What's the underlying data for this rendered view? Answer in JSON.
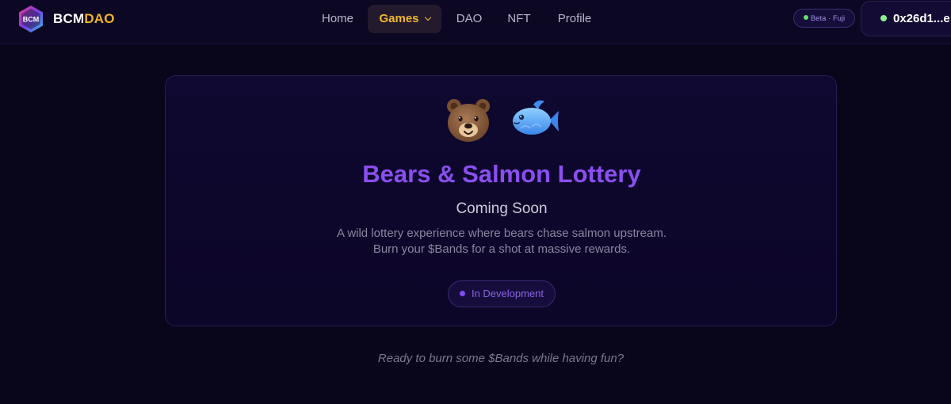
{
  "brand": {
    "part1": "BCM",
    "part2": "DAO",
    "logo_text": "BCM"
  },
  "nav": {
    "home": "Home",
    "games": "Games",
    "dao": "DAO",
    "nft": "NFT",
    "profile": "Profile"
  },
  "network": {
    "label": "Beta · Fuji",
    "status_color": "#66e06d"
  },
  "wallet": {
    "address": "0x26d1...e"
  },
  "game_card": {
    "icons": [
      "bear-emoji",
      "fish-emoji"
    ],
    "title": "Bears & Salmon Lottery",
    "subtitle": "Coming Soon",
    "description_line1": "A wild lottery experience where bears chase salmon upstream.",
    "description_line2": "Burn your $Bands for a shot at massive rewards.",
    "status": "In Development"
  },
  "footer": {
    "tagline": "Ready to burn some $Bands while having fun?"
  },
  "colors": {
    "background": "#09051a",
    "accent_purple": "#8a4ff0",
    "accent_gold": "#f2b72c"
  }
}
